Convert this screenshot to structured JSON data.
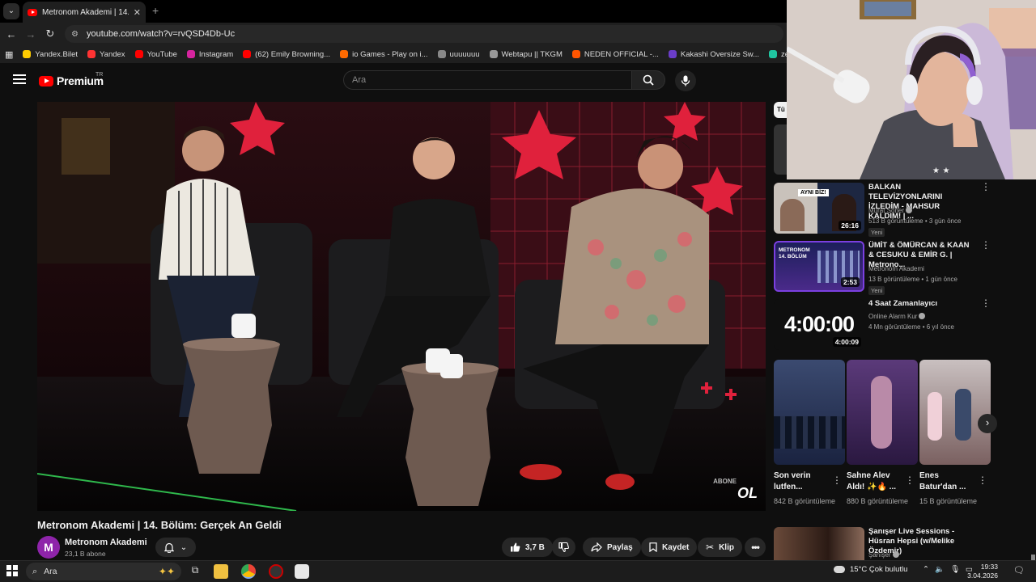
{
  "browser": {
    "tab_title": "Metronom Akademi | 14. Bölüm",
    "url": "youtube.com/watch?v=rvQSD4Db-Uc",
    "bookmarks": [
      {
        "label": "Yandex.Bilet",
        "color": "#ffcc00"
      },
      {
        "label": "Yandex",
        "color": "#ff3333"
      },
      {
        "label": "YouTube",
        "color": "#ff0000"
      },
      {
        "label": "Instagram",
        "color": "#d6249f"
      },
      {
        "label": "(62) Emily Browning...",
        "color": "#ff0000"
      },
      {
        "label": "io Games - Play on i...",
        "color": "#ff6a00"
      },
      {
        "label": "uuuuuuu",
        "color": "#888888"
      },
      {
        "label": "Webtapu || TKGM",
        "color": "#999999"
      },
      {
        "label": "NEDEN OFFICIAL -...",
        "color": "#ff5500"
      },
      {
        "label": "Kakashi Oversize Sw...",
        "color": "#6a3dc8"
      },
      {
        "label": "zelderler - Streamer...",
        "color": "#20c5a0"
      },
      {
        "label": "Nike Pr",
        "color": "#ffffff"
      }
    ]
  },
  "header": {
    "logo_text": "Premium",
    "region": "TR",
    "search_placeholder": "Ara"
  },
  "video": {
    "title": "Metronom Akademi | 14. Bölüm: Gerçek An Geldi",
    "watermark": "ABONE OL",
    "channel": "Metronom Akademi",
    "channel_initial": "M",
    "subscribers": "23,1 B abone",
    "likes": "3,7 B",
    "share": "Paylaş",
    "save": "Kaydet",
    "clip": "Klip"
  },
  "sidebar": {
    "top_chip": "Tü",
    "items": [
      {
        "title": "BALKAN TELEVİZYONLARINI İZLEDİM - MAHSUR KALDIM! | ...",
        "channel": "Murat Soner",
        "meta": "513 B görüntüleme • 3 gün önce",
        "badge": "Yeni",
        "duration": "26:16",
        "thumb_text": "AYNI BİZ!"
      },
      {
        "title": "ÜMİT & ÖMÜRCAN & KAAN & CESUKU & EMİR G. | Metrono...",
        "channel": "Metronom Akademi",
        "meta": "13 B görüntüleme • 1 gün önce",
        "badge": "Yeni",
        "duration": "2:53",
        "thumb_text": "METRONOM 14. BÖLÜM"
      },
      {
        "title": "4 Saat Zamanlayıcı",
        "channel": "Online Alarm Kur",
        "meta": "4 Mn görüntüleme • 6 yıl önce",
        "duration": "4:00:09",
        "thumb_text": "4:00:00"
      }
    ],
    "shorts": [
      {
        "title": "Son verin lutfen...",
        "views": "842 B görüntüleme"
      },
      {
        "title": "Sahne Alev Aldı! ✨🔥 ...",
        "views": "880 B görüntüleme"
      },
      {
        "title": "Enes Batur'dan ...",
        "views": "15 B görüntüleme"
      }
    ],
    "last_item": {
      "title": "Şanışer Live Sessions - Hüsran Hepsi (w/Melike Özdemir)",
      "channel": "Şanışer"
    }
  },
  "taskbar": {
    "search_placeholder": "Ara",
    "weather": "15°C  Çok bulutlu",
    "time": "19:33",
    "date": "3.04.2026"
  }
}
